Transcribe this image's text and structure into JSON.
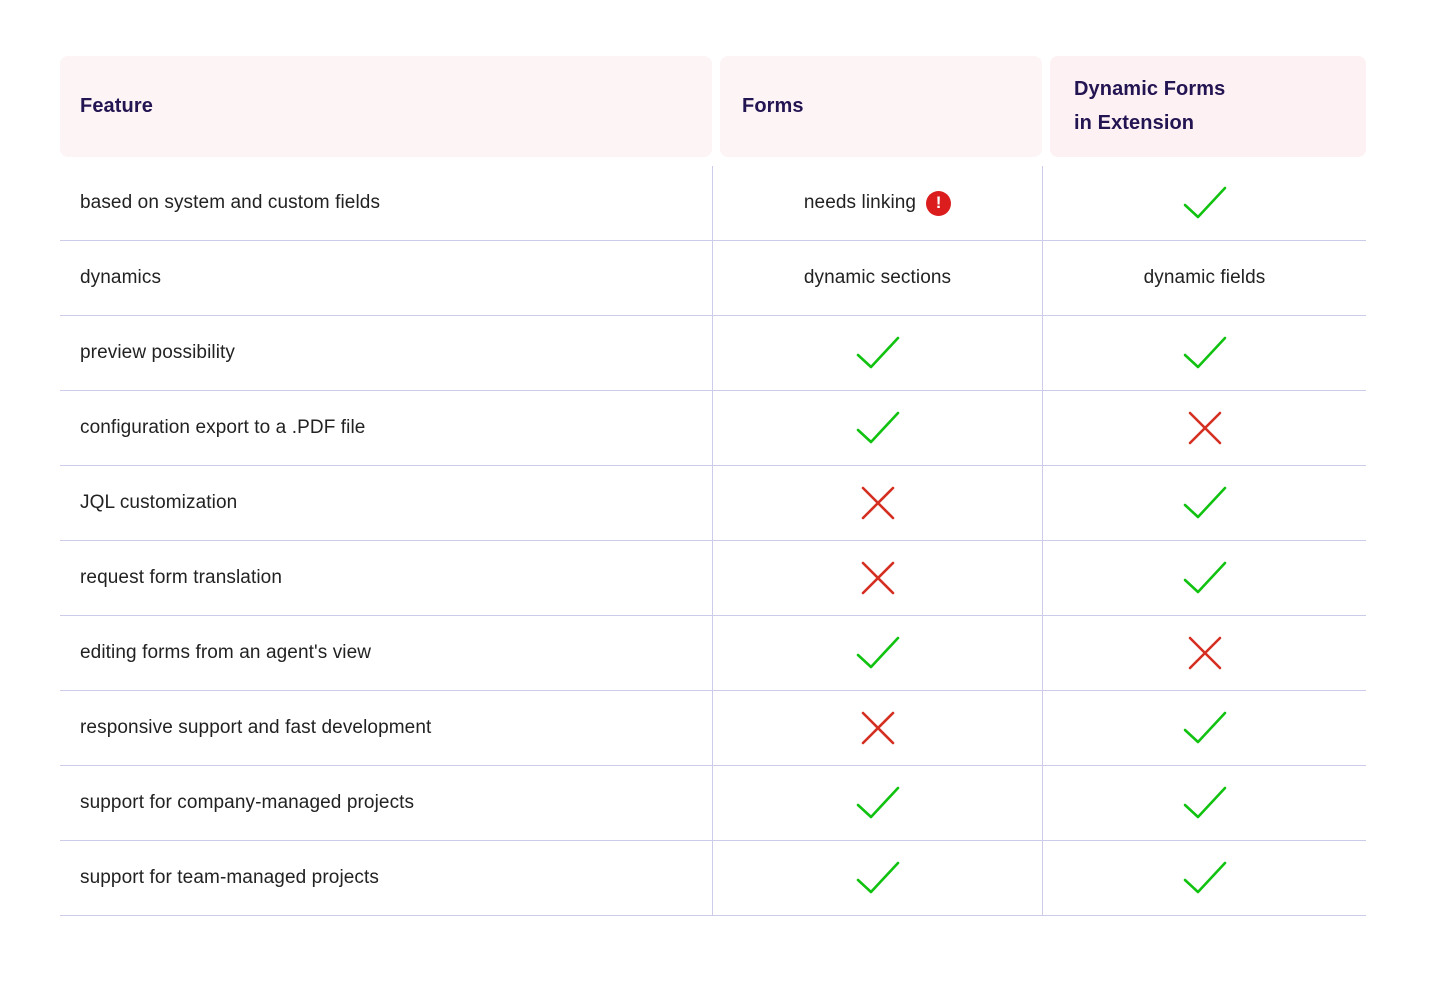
{
  "table": {
    "columns": [
      {
        "key": "feature",
        "label": "Feature"
      },
      {
        "key": "forms",
        "label": "Forms"
      },
      {
        "key": "dynamic",
        "label_line1": "Dynamic Forms",
        "label_line2": "in Extension"
      }
    ],
    "rows": [
      {
        "feature": "based on system and custom fields",
        "forms": {
          "type": "text-warning",
          "text": "needs linking",
          "badge": "!"
        },
        "dynamic": {
          "type": "check"
        }
      },
      {
        "feature": "dynamics",
        "forms": {
          "type": "text",
          "text": "dynamic sections"
        },
        "dynamic": {
          "type": "text",
          "text": "dynamic fields"
        }
      },
      {
        "feature": "preview possibility",
        "forms": {
          "type": "check"
        },
        "dynamic": {
          "type": "check"
        }
      },
      {
        "feature": "configuration export to a .PDF file",
        "forms": {
          "type": "check"
        },
        "dynamic": {
          "type": "cross"
        }
      },
      {
        "feature": "JQL customization",
        "forms": {
          "type": "cross"
        },
        "dynamic": {
          "type": "check"
        }
      },
      {
        "feature": "request form translation",
        "forms": {
          "type": "cross"
        },
        "dynamic": {
          "type": "check"
        }
      },
      {
        "feature": "editing forms from an agent's view",
        "forms": {
          "type": "check"
        },
        "dynamic": {
          "type": "cross"
        }
      },
      {
        "feature": "responsive support and fast development",
        "forms": {
          "type": "cross"
        },
        "dynamic": {
          "type": "check"
        }
      },
      {
        "feature": "support for company-managed projects",
        "forms": {
          "type": "check"
        },
        "dynamic": {
          "type": "check"
        }
      },
      {
        "feature": "support for team-managed projects",
        "forms": {
          "type": "check"
        },
        "dynamic": {
          "type": "check"
        }
      }
    ]
  },
  "icons": {
    "check": "check-icon",
    "cross": "cross-icon",
    "warning": "warning-exclamation-icon"
  },
  "colors": {
    "check": "#11c211",
    "cross": "#d42f21",
    "warning_badge": "#db1d1d",
    "header_text": "#231452",
    "header_bg": "#fdf4f5",
    "header_bg_accent": "#fdf1f3",
    "divider": "#ccccea",
    "body_text": "#222222"
  }
}
